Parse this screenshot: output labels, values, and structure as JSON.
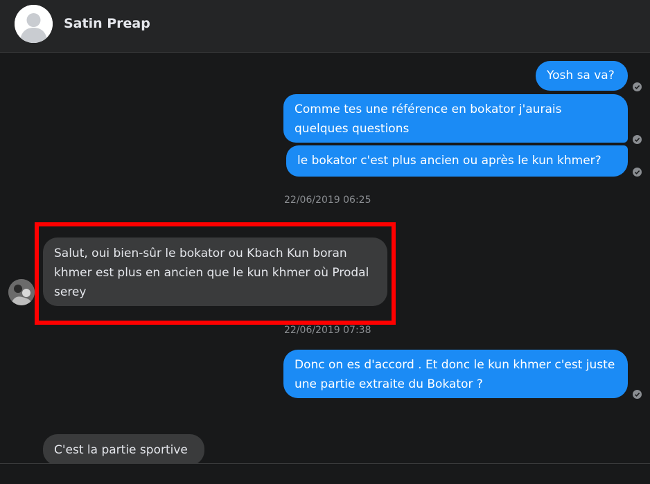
{
  "header": {
    "contact_name": "Satin Preap",
    "avatar_icon": "default-profile-avatar-icon"
  },
  "conversation": {
    "messages": [
      {
        "direction": "outgoing",
        "text": "Yosh sa va?",
        "status_icon": "sent-check-icon"
      },
      {
        "direction": "outgoing",
        "text": "Comme tes une référence en bokator j'aurais quelques questions",
        "status_icon": "sent-check-icon"
      },
      {
        "direction": "outgoing",
        "text": "le bokator c'est plus ancien ou après le kun khmer?",
        "status_icon": "sent-check-icon"
      },
      {
        "direction": "timestamp",
        "text": "22/06/2019 06:25"
      },
      {
        "direction": "incoming",
        "text": "Salut, oui bien-sûr le bokator ou Kbach Kun boran khmer est plus en ancien que le kun khmer où Prodal serey",
        "highlighted": true
      },
      {
        "direction": "timestamp",
        "text": "22/06/2019 07:38"
      },
      {
        "direction": "outgoing",
        "text": "Donc on es d'accord . Et donc le kun khmer c'est juste une partie extraite du Bokator ?",
        "status_icon": "sent-check-icon"
      },
      {
        "direction": "incoming",
        "text": "C'est la partie sportive"
      }
    ]
  },
  "colors": {
    "background": "#18191a",
    "header": "#242526",
    "outgoing_bubble": "#1b8bf5",
    "incoming_bubble": "#3a3b3c",
    "highlight_border": "#ff0000",
    "timestamp_text": "#8a8d91"
  }
}
